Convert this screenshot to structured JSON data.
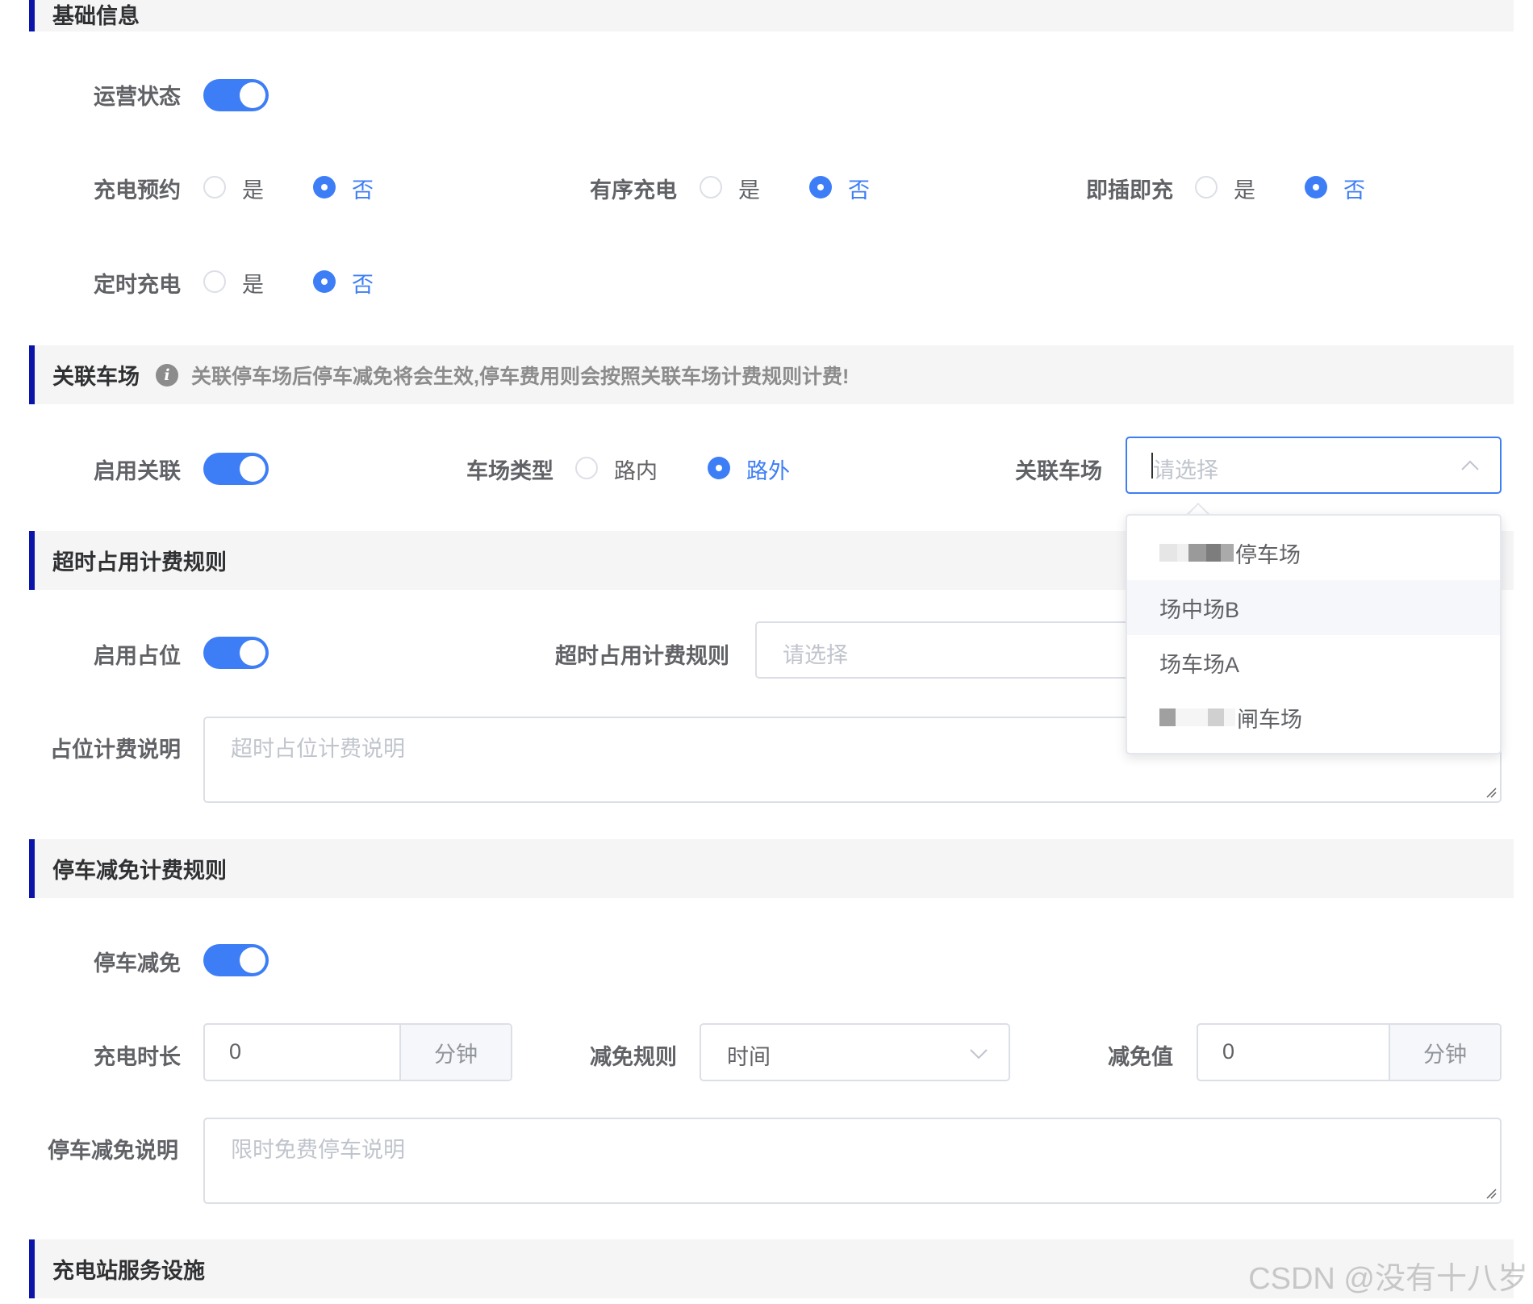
{
  "sections": {
    "basic": {
      "title": "基础信息"
    },
    "parking": {
      "title": "关联车场",
      "tip": "关联停车场后停车减免将会生效,停车费用则会按照关联车场计费规则计费!"
    },
    "overtime": {
      "title": "超时占用计费规则"
    },
    "reduction": {
      "title": "停车减免计费规则"
    },
    "facilities": {
      "title": "充电站服务设施"
    }
  },
  "basic": {
    "operation_status": {
      "label": "运营状态",
      "on": true
    },
    "charge_reservation": {
      "label": "充电预约",
      "options": [
        "是",
        "否"
      ],
      "selected": "否"
    },
    "ordered_charging": {
      "label": "有序充电",
      "options": [
        "是",
        "否"
      ],
      "selected": "否"
    },
    "plug_and_charge": {
      "label": "即插即充",
      "options": [
        "是",
        "否"
      ],
      "selected": "否"
    },
    "timed_charging": {
      "label": "定时充电",
      "options": [
        "是",
        "否"
      ],
      "selected": "否"
    }
  },
  "parking": {
    "enable_link": {
      "label": "启用关联",
      "on": true
    },
    "lot_type": {
      "label": "车场类型",
      "options": [
        "路内",
        "路外"
      ],
      "selected": "路外"
    },
    "linked_lot": {
      "label": "关联车场",
      "placeholder": "请选择",
      "open": true
    },
    "dropdown_options": [
      "停车场",
      "场中场B",
      "场车场A",
      "闸车场"
    ],
    "hovered_option": "场中场B"
  },
  "overtime": {
    "enable_occupy": {
      "label": "启用占位",
      "on": true
    },
    "rule": {
      "label": "超时占用计费规则",
      "placeholder": "请选择"
    },
    "description": {
      "label": "占位计费说明",
      "placeholder": "超时占位计费说明"
    }
  },
  "reduction": {
    "parking_reduction": {
      "label": "停车减免",
      "on": true
    },
    "charge_duration": {
      "label": "充电时长",
      "value": "0",
      "unit": "分钟"
    },
    "reduction_rule": {
      "label": "减免规则",
      "value": "时间"
    },
    "reduction_value": {
      "label": "减免值",
      "value": "0",
      "unit": "分钟"
    },
    "description": {
      "label": "停车减免说明",
      "placeholder": "限时免费停车说明"
    }
  },
  "watermark": "CSDN @没有十八岁",
  "colors": {
    "accent": "#3d7ef6",
    "section_bar": "#0b14a8",
    "section_bg": "#f5f5f6"
  }
}
